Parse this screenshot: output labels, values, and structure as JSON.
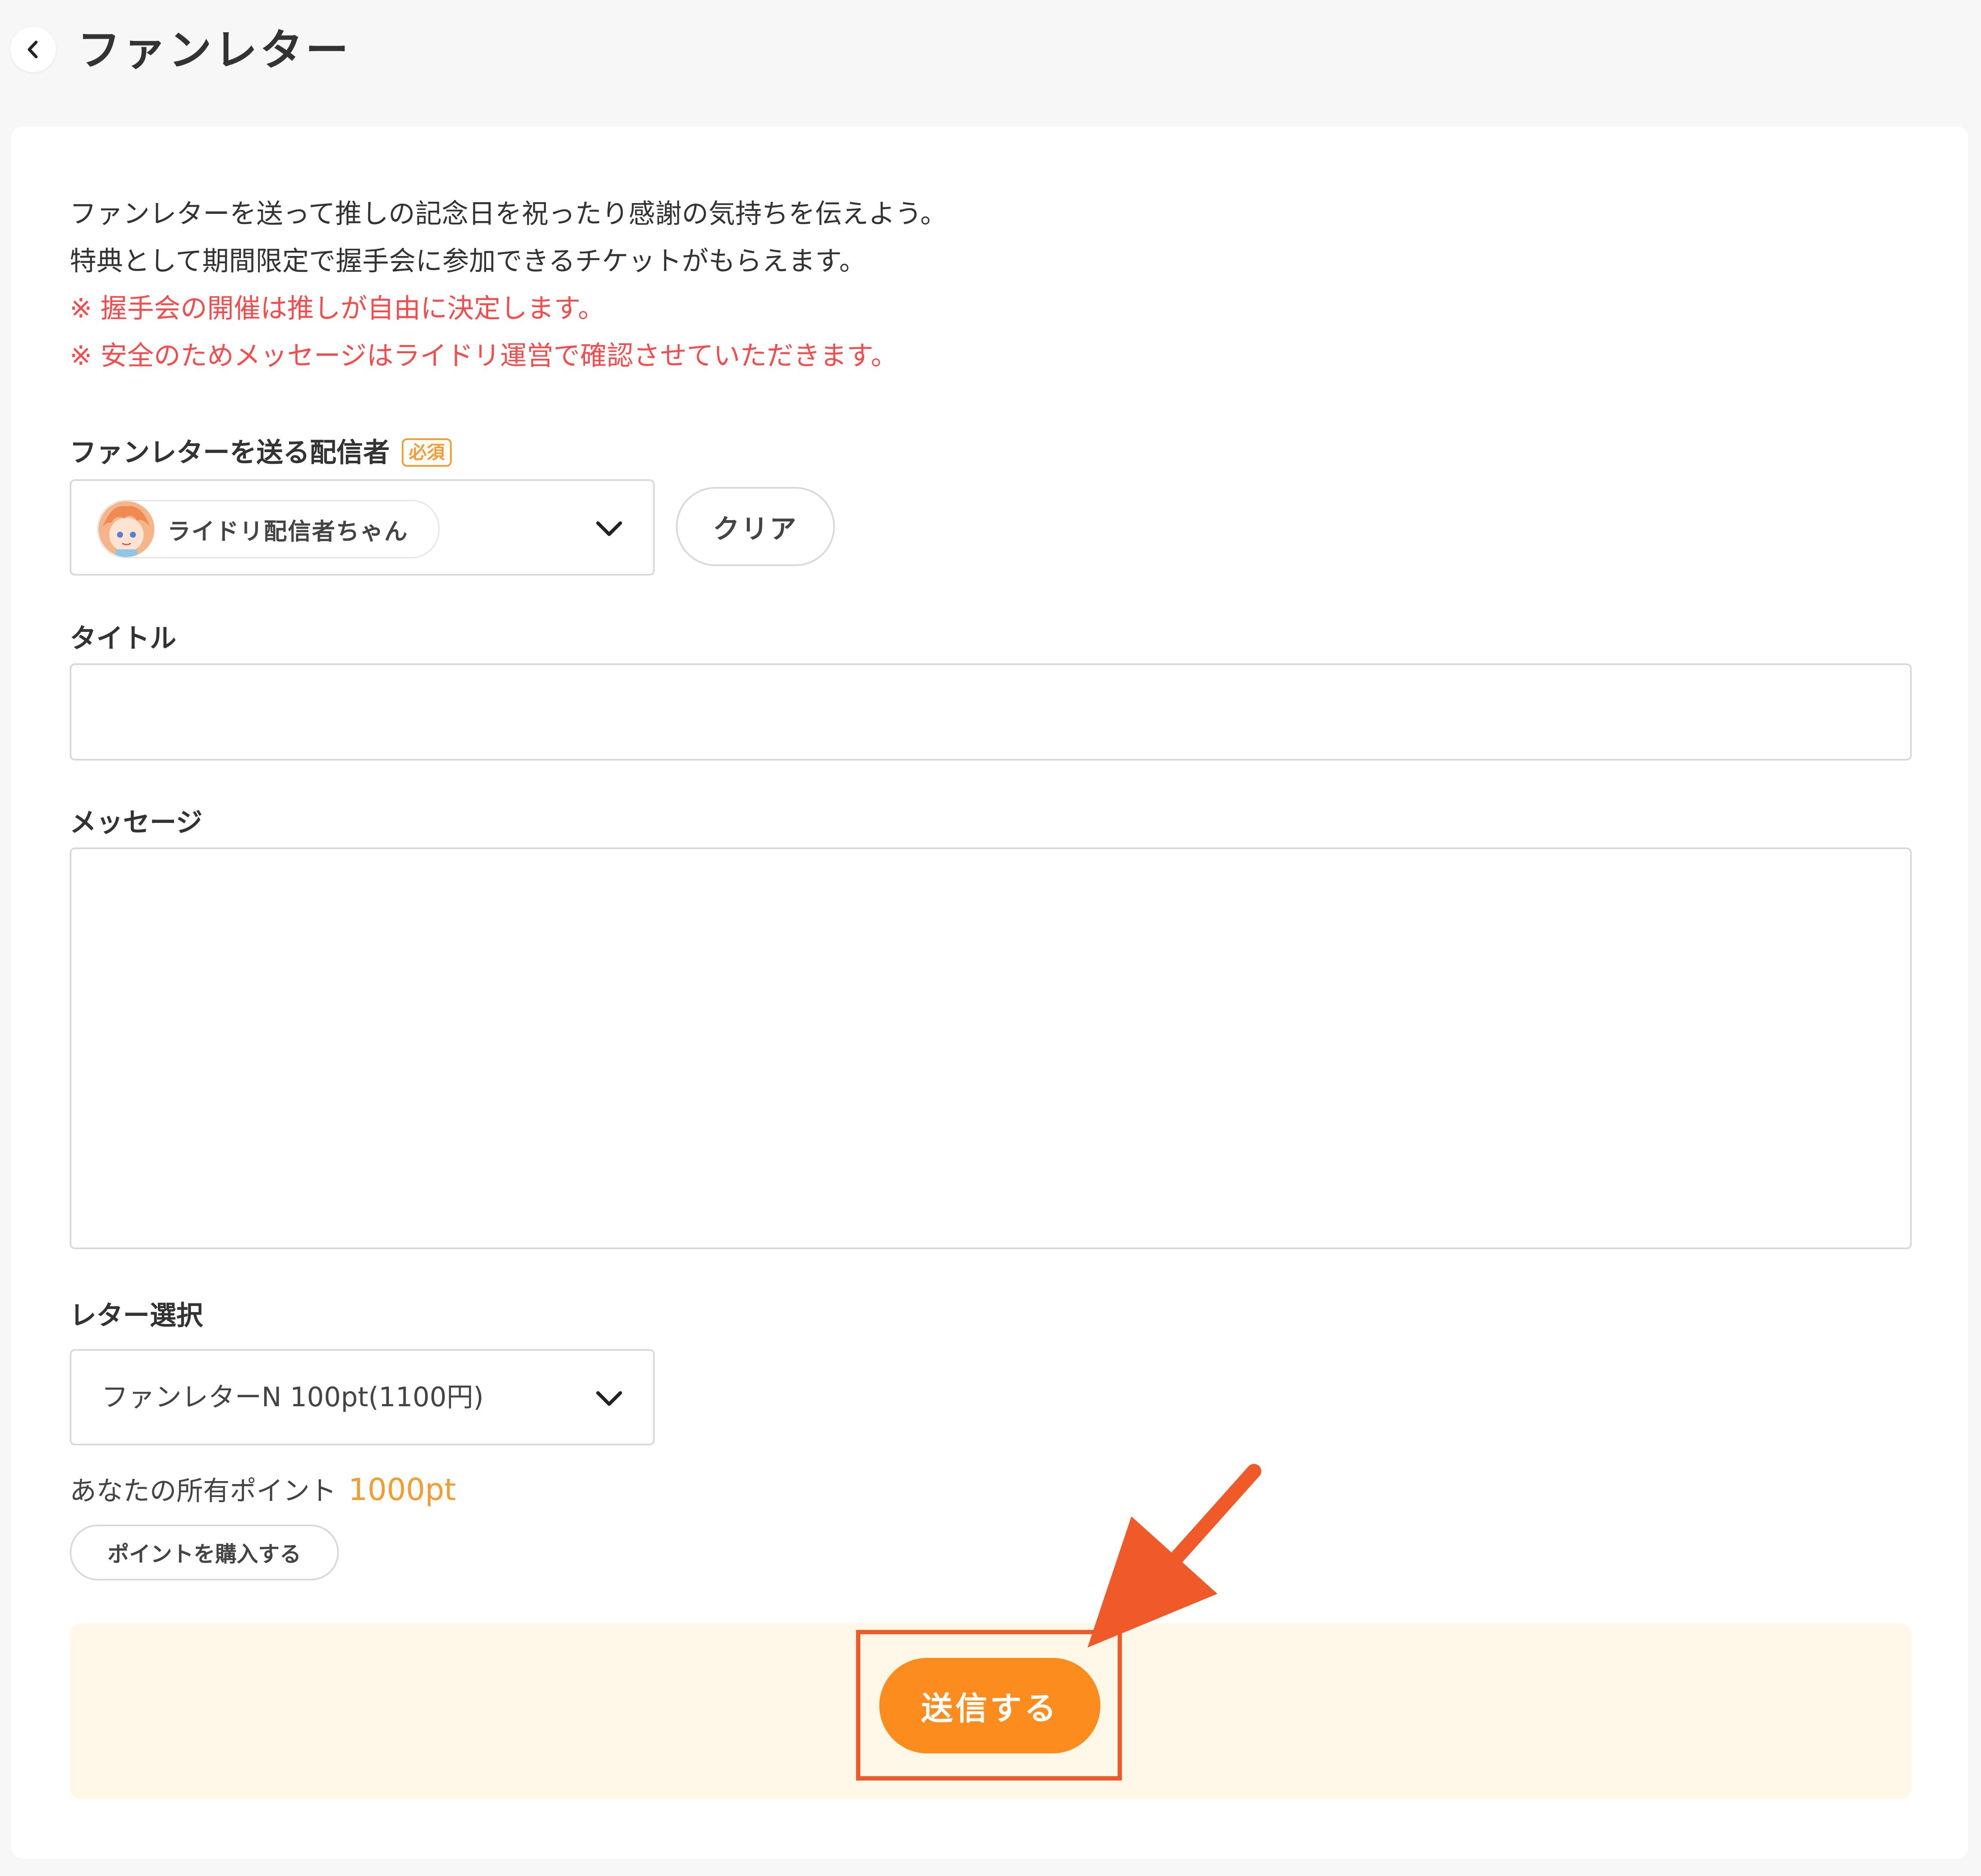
{
  "header": {
    "title": "ファンレター",
    "back_icon": "chevron-left-icon"
  },
  "intro": {
    "lines": [
      "ファンレターを送って推しの記念日を祝ったり感謝の気持ちを伝えよう。",
      "特典として期間限定で握手会に参加できるチケットがもらえます。"
    ],
    "notices": [
      "※ 握手会の開催は推しが自由に決定します。",
      "※ 安全のためメッセージはライドリ運営で確認させていただきます。"
    ],
    "notice_color": "#f44c4c"
  },
  "recipient": {
    "label": "ファンレターを送る配信者",
    "required_badge": "必須",
    "selected": "ライドリ配信者ちゃん",
    "clear_label": "クリア"
  },
  "title_field": {
    "label": "タイトル",
    "value": ""
  },
  "message_field": {
    "label": "メッセージ",
    "value": ""
  },
  "letter_select": {
    "label": "レター選択",
    "selected": "ファンレターN 100pt(1100円)"
  },
  "points": {
    "label": "あなたの所有ポイント",
    "value": "1000pt",
    "buy_label": "ポイントを購入する"
  },
  "submit": {
    "label": "送信する",
    "color": "#fb8c1d"
  },
  "colors": {
    "accent": "#f59b2f",
    "annotation": "#f05a28",
    "panel_bg": "#fff8e8"
  }
}
